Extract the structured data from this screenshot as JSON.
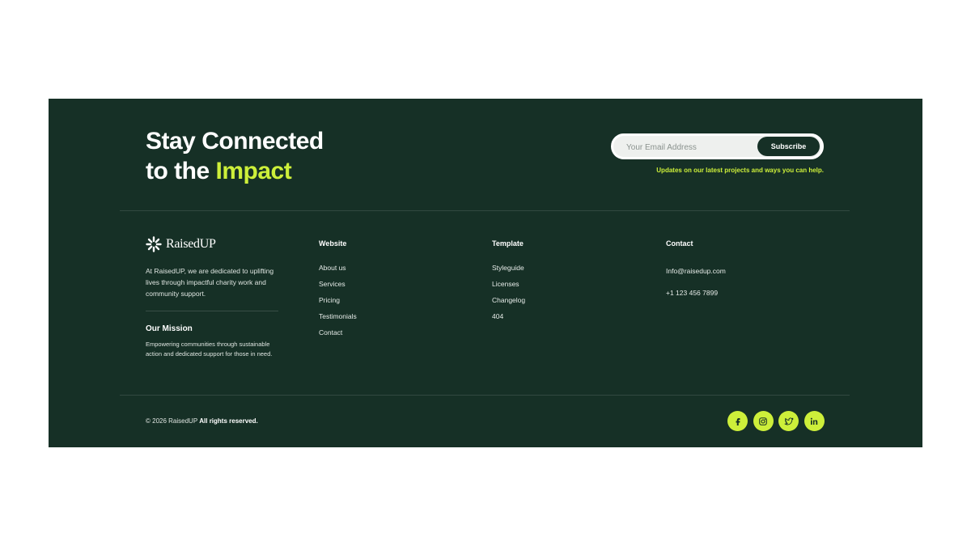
{
  "hero": {
    "title_line1": "Stay Connected",
    "title_line2_prefix": "to the ",
    "title_line2_accent": "Impact"
  },
  "subscribe": {
    "placeholder": "Your Email Address",
    "button_label": "Subscribe",
    "note": "Updates on our latest projects and ways you can help."
  },
  "brand": {
    "name": "RaisedUP",
    "about": "At RaisedUP, we are dedicated to uplifting lives through impactful charity work and community support.",
    "mission_title": "Our Mission",
    "mission_text": "Empowering communities through sustainable action and dedicated support for those in need."
  },
  "columns": {
    "website": {
      "title": "Website",
      "items": [
        "About us",
        "Services",
        "Pricing",
        "Testimonials",
        "Contact"
      ]
    },
    "template": {
      "title": "Template",
      "items": [
        "Styleguide",
        "Licenses",
        "Changelog",
        "404"
      ]
    },
    "contact": {
      "title": "Contact",
      "items": [
        "Info@raisedup.com",
        "+1 123 456 7899"
      ]
    }
  },
  "bottom": {
    "copyright_prefix": "© 2026 RaisedUP",
    "copyright_bold": "All rights reserved."
  },
  "socials": [
    "facebook-icon",
    "instagram-icon",
    "twitter-icon",
    "linkedin-icon"
  ],
  "colors": {
    "background": "#163026",
    "accent": "#cdef3a",
    "text": "#ffffff"
  }
}
